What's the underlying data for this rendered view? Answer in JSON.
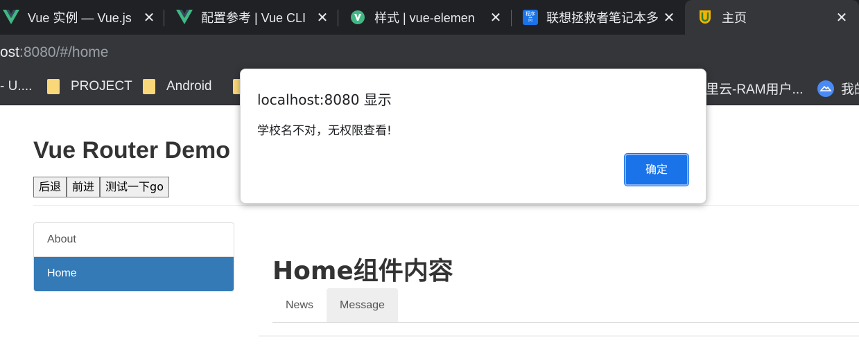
{
  "browser": {
    "tabs": [
      {
        "title": "Vue 实例 — Vue.js",
        "icon": "vue-logo-icon"
      },
      {
        "title": "配置参考 | Vue CLI",
        "icon": "vue-logo-icon"
      },
      {
        "title": "样式 | vue-elemen",
        "icon": "vue-element-logo-icon"
      },
      {
        "title": "联想拯救者笔记本多",
        "icon": "chengxuyuan-logo-icon",
        "icon_text": "程序员"
      },
      {
        "title": "主页",
        "icon": "site-u-logo-icon",
        "active": true
      }
    ],
    "close_glyph": "✕",
    "address": {
      "host": "ost",
      "rest": ":8080/#/home"
    },
    "bookmarks": [
      {
        "label": "- U...."
      },
      {
        "label": "PROJECT"
      },
      {
        "label": "Android"
      },
      {
        "label": "里云-RAM用户..."
      },
      {
        "label": "我的"
      }
    ]
  },
  "page": {
    "title": "Vue Router Demo",
    "buttons": [
      "后退",
      "前进",
      "测试一下go"
    ],
    "nav": [
      {
        "label": "About",
        "active": false
      },
      {
        "label": "Home",
        "active": true
      }
    ],
    "home_title": "Home组件内容",
    "subtabs": [
      {
        "label": "News",
        "active": false
      },
      {
        "label": "Message",
        "active": true
      }
    ]
  },
  "dialog": {
    "title": "localhost:8080 显示",
    "message": "学校名不对，无权限查看!",
    "ok_label": "确定"
  },
  "colors": {
    "accent": "#1a73e8",
    "nav_active": "#337ab7"
  }
}
